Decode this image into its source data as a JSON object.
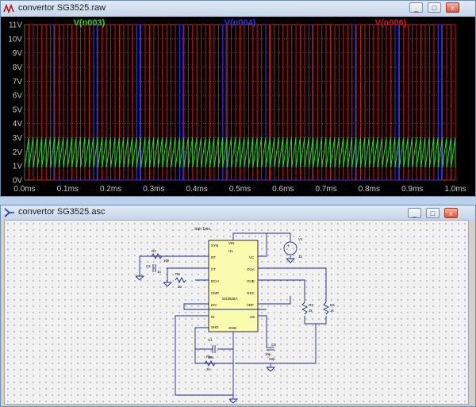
{
  "waveform_window": {
    "title": "convertor SG3525.raw",
    "controls": [
      "_",
      "□",
      "x"
    ]
  },
  "schematic_window": {
    "title": "convertor SG3525.asc",
    "controls": [
      "_",
      "□",
      "x"
    ]
  },
  "chart_data": {
    "type": "line",
    "title": "",
    "xlabel": "",
    "ylabel": "",
    "xlim": [
      0,
      1.0
    ],
    "ylim": [
      0,
      11
    ],
    "grid": true,
    "x_ticks": [
      "0.0ms",
      "0.1ms",
      "0.2ms",
      "0.3ms",
      "0.4ms",
      "0.5ms",
      "0.6ms",
      "0.7ms",
      "0.8ms",
      "0.9ms",
      "1.0ms"
    ],
    "y_ticks": [
      "0V",
      "1V",
      "2V",
      "3V",
      "4V",
      "5V",
      "6V",
      "7V",
      "8V",
      "9V",
      "10V",
      "11V"
    ],
    "colors": {
      "background": "#000000",
      "grid": "#8a7a3a",
      "axis_text": "#c8c8c8"
    },
    "series": [
      {
        "name": "V(n003)",
        "color": "#22dd22",
        "shape": "sawtooth",
        "low": 0.9,
        "high": 3.0,
        "period_ms": 0.01
      },
      {
        "name": "V(n004)",
        "color": "#3333ee",
        "shape": "pulse",
        "low": 0.0,
        "high": 11.0,
        "period_ms": 0.1,
        "high_width_ms": 0.008
      },
      {
        "name": "V(n006)",
        "color": "#dd1111",
        "shape": "pulse",
        "low": 0.0,
        "high": 11.0,
        "period_ms": 0.02,
        "high_width_ms": 0.01
      }
    ]
  },
  "schematic": {
    "directive": ".tran 1ms",
    "ic": {
      "ref": "U1",
      "part": "SG3526A",
      "pins_left": [
        "SYN",
        "RT",
        "CT",
        "DCH",
        "CMP",
        "INV",
        "NI",
        "SHD"
      ],
      "pins_right": [
        "VC",
        "OUA",
        "OUB",
        "OSC",
        "VRF",
        "SS"
      ],
      "pin_top": "VIN",
      "pin_bottom": "GND"
    },
    "components": [
      {
        "ref": "R2",
        "value": "10k"
      },
      {
        "ref": "C2",
        "value": "1n"
      },
      {
        "ref": "R6",
        "value": "20"
      },
      {
        "ref": "V1",
        "value": "12"
      },
      {
        "ref": "R3",
        "value": "1k"
      },
      {
        "ref": "R4",
        "value": "1k"
      },
      {
        "ref": "C1",
        "value": "10n"
      },
      {
        "ref": "R1",
        "value": "1k"
      },
      {
        "ref": "C3",
        "value": "10p"
      },
      {
        "ref": "C3b",
        "value": "33p"
      }
    ]
  }
}
